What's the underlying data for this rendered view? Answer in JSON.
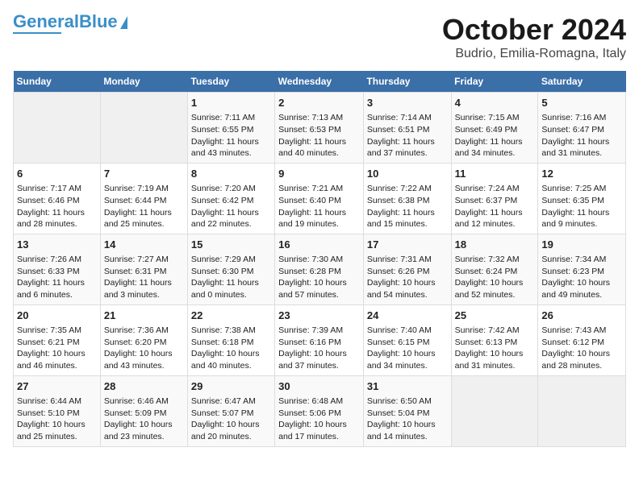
{
  "header": {
    "logo_general": "General",
    "logo_blue": "Blue",
    "title": "October 2024",
    "subtitle": "Budrio, Emilia-Romagna, Italy"
  },
  "days_of_week": [
    "Sunday",
    "Monday",
    "Tuesday",
    "Wednesday",
    "Thursday",
    "Friday",
    "Saturday"
  ],
  "weeks": [
    [
      {
        "day": "",
        "info": ""
      },
      {
        "day": "",
        "info": ""
      },
      {
        "day": "1",
        "info": "Sunrise: 7:11 AM\nSunset: 6:55 PM\nDaylight: 11 hours and 43 minutes."
      },
      {
        "day": "2",
        "info": "Sunrise: 7:13 AM\nSunset: 6:53 PM\nDaylight: 11 hours and 40 minutes."
      },
      {
        "day": "3",
        "info": "Sunrise: 7:14 AM\nSunset: 6:51 PM\nDaylight: 11 hours and 37 minutes."
      },
      {
        "day": "4",
        "info": "Sunrise: 7:15 AM\nSunset: 6:49 PM\nDaylight: 11 hours and 34 minutes."
      },
      {
        "day": "5",
        "info": "Sunrise: 7:16 AM\nSunset: 6:47 PM\nDaylight: 11 hours and 31 minutes."
      }
    ],
    [
      {
        "day": "6",
        "info": "Sunrise: 7:17 AM\nSunset: 6:46 PM\nDaylight: 11 hours and 28 minutes."
      },
      {
        "day": "7",
        "info": "Sunrise: 7:19 AM\nSunset: 6:44 PM\nDaylight: 11 hours and 25 minutes."
      },
      {
        "day": "8",
        "info": "Sunrise: 7:20 AM\nSunset: 6:42 PM\nDaylight: 11 hours and 22 minutes."
      },
      {
        "day": "9",
        "info": "Sunrise: 7:21 AM\nSunset: 6:40 PM\nDaylight: 11 hours and 19 minutes."
      },
      {
        "day": "10",
        "info": "Sunrise: 7:22 AM\nSunset: 6:38 PM\nDaylight: 11 hours and 15 minutes."
      },
      {
        "day": "11",
        "info": "Sunrise: 7:24 AM\nSunset: 6:37 PM\nDaylight: 11 hours and 12 minutes."
      },
      {
        "day": "12",
        "info": "Sunrise: 7:25 AM\nSunset: 6:35 PM\nDaylight: 11 hours and 9 minutes."
      }
    ],
    [
      {
        "day": "13",
        "info": "Sunrise: 7:26 AM\nSunset: 6:33 PM\nDaylight: 11 hours and 6 minutes."
      },
      {
        "day": "14",
        "info": "Sunrise: 7:27 AM\nSunset: 6:31 PM\nDaylight: 11 hours and 3 minutes."
      },
      {
        "day": "15",
        "info": "Sunrise: 7:29 AM\nSunset: 6:30 PM\nDaylight: 11 hours and 0 minutes."
      },
      {
        "day": "16",
        "info": "Sunrise: 7:30 AM\nSunset: 6:28 PM\nDaylight: 10 hours and 57 minutes."
      },
      {
        "day": "17",
        "info": "Sunrise: 7:31 AM\nSunset: 6:26 PM\nDaylight: 10 hours and 54 minutes."
      },
      {
        "day": "18",
        "info": "Sunrise: 7:32 AM\nSunset: 6:24 PM\nDaylight: 10 hours and 52 minutes."
      },
      {
        "day": "19",
        "info": "Sunrise: 7:34 AM\nSunset: 6:23 PM\nDaylight: 10 hours and 49 minutes."
      }
    ],
    [
      {
        "day": "20",
        "info": "Sunrise: 7:35 AM\nSunset: 6:21 PM\nDaylight: 10 hours and 46 minutes."
      },
      {
        "day": "21",
        "info": "Sunrise: 7:36 AM\nSunset: 6:20 PM\nDaylight: 10 hours and 43 minutes."
      },
      {
        "day": "22",
        "info": "Sunrise: 7:38 AM\nSunset: 6:18 PM\nDaylight: 10 hours and 40 minutes."
      },
      {
        "day": "23",
        "info": "Sunrise: 7:39 AM\nSunset: 6:16 PM\nDaylight: 10 hours and 37 minutes."
      },
      {
        "day": "24",
        "info": "Sunrise: 7:40 AM\nSunset: 6:15 PM\nDaylight: 10 hours and 34 minutes."
      },
      {
        "day": "25",
        "info": "Sunrise: 7:42 AM\nSunset: 6:13 PM\nDaylight: 10 hours and 31 minutes."
      },
      {
        "day": "26",
        "info": "Sunrise: 7:43 AM\nSunset: 6:12 PM\nDaylight: 10 hours and 28 minutes."
      }
    ],
    [
      {
        "day": "27",
        "info": "Sunrise: 6:44 AM\nSunset: 5:10 PM\nDaylight: 10 hours and 25 minutes."
      },
      {
        "day": "28",
        "info": "Sunrise: 6:46 AM\nSunset: 5:09 PM\nDaylight: 10 hours and 23 minutes."
      },
      {
        "day": "29",
        "info": "Sunrise: 6:47 AM\nSunset: 5:07 PM\nDaylight: 10 hours and 20 minutes."
      },
      {
        "day": "30",
        "info": "Sunrise: 6:48 AM\nSunset: 5:06 PM\nDaylight: 10 hours and 17 minutes."
      },
      {
        "day": "31",
        "info": "Sunrise: 6:50 AM\nSunset: 5:04 PM\nDaylight: 10 hours and 14 minutes."
      },
      {
        "day": "",
        "info": ""
      },
      {
        "day": "",
        "info": ""
      }
    ]
  ]
}
